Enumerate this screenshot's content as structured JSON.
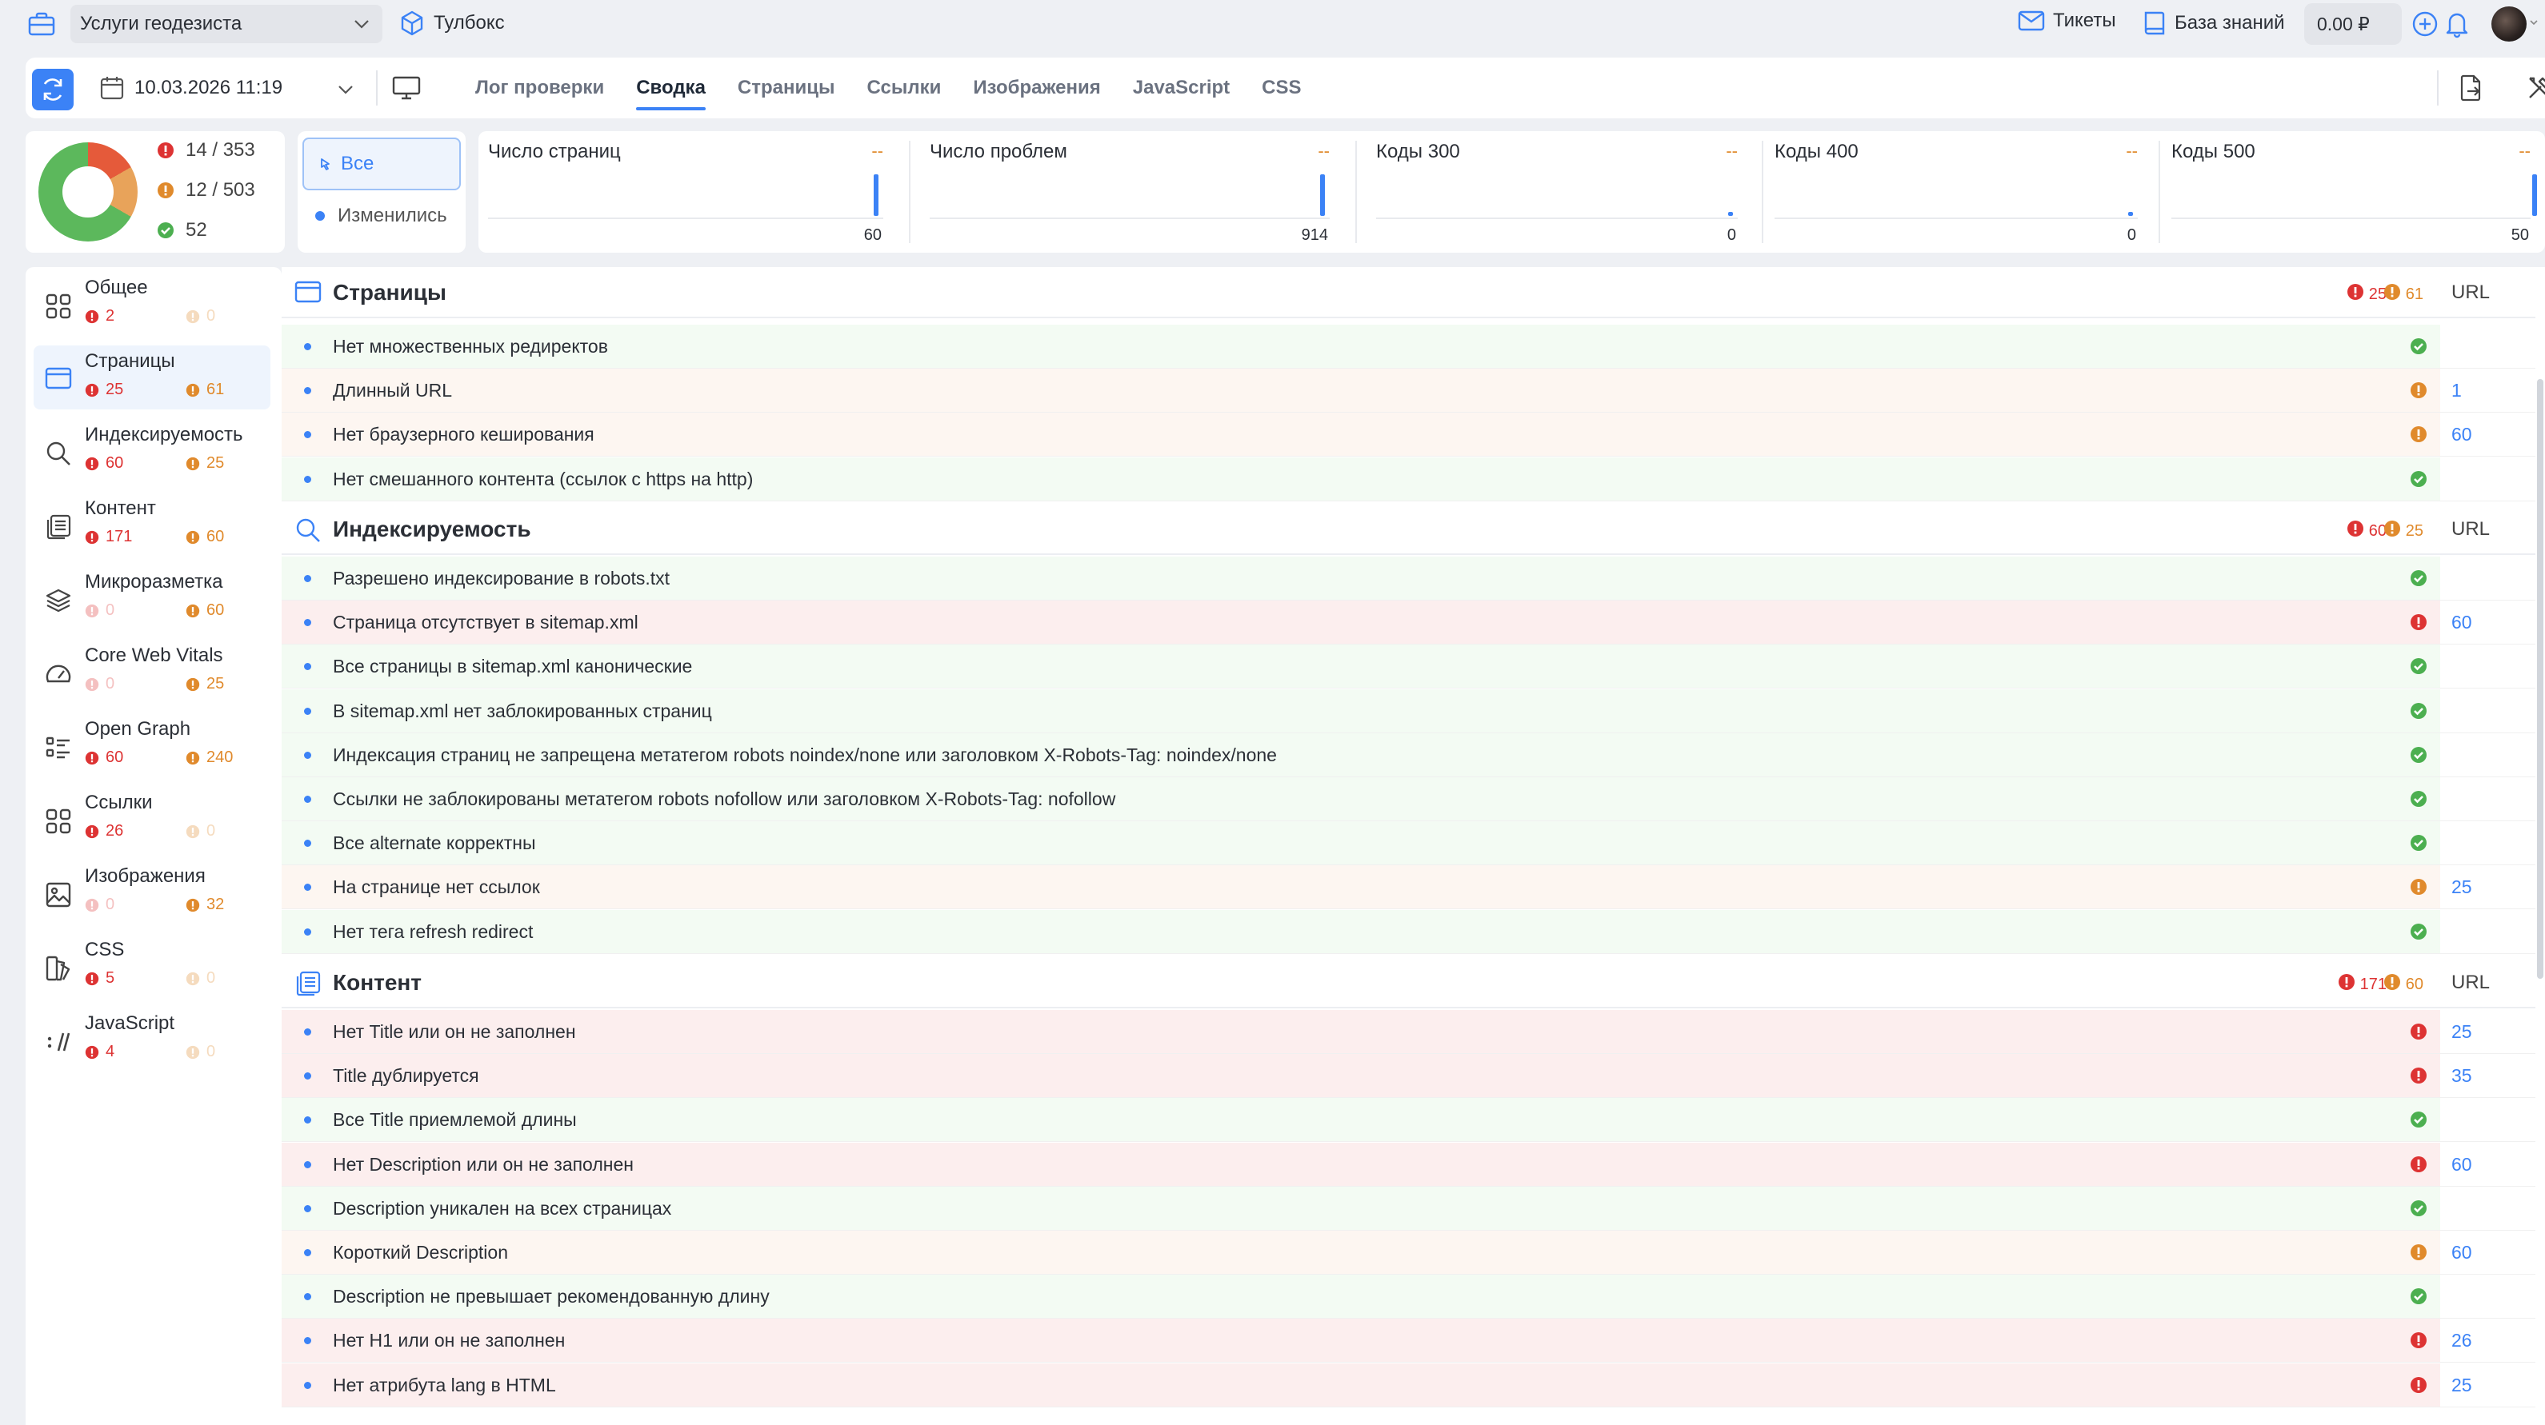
{
  "topbar": {
    "project": "Услуги геодезиста",
    "toolbox": "Тулбокс",
    "tickets": "Тикеты",
    "knowledge_base": "База знаний",
    "balance": "0.00 ₽"
  },
  "tabbar": {
    "date": "10.03.2026 11:19",
    "tabs": [
      "Лог проверки",
      "Сводка",
      "Страницы",
      "Ссылки",
      "Изображения",
      "JavaScript",
      "CSS"
    ],
    "active_tab": "Сводка"
  },
  "summary": {
    "errors": "14 / 353",
    "warnings": "12 / 503",
    "ok": "52",
    "filter_all": "Все",
    "filter_changed": "Изменились"
  },
  "metrics": [
    {
      "title": "Число страниц",
      "delta": "--",
      "value": "60"
    },
    {
      "title": "Число проблем",
      "delta": "--",
      "value": "914"
    },
    {
      "title": "Коды 300",
      "delta": "--",
      "value": "0"
    },
    {
      "title": "Коды 400",
      "delta": "--",
      "value": "0"
    },
    {
      "title": "Коды 500",
      "delta": "--",
      "value": "50"
    }
  ],
  "sidebar": [
    {
      "label": "Общее",
      "err": "2",
      "warn": "0",
      "icon": "grid-icon"
    },
    {
      "label": "Страницы",
      "err": "25",
      "warn": "61",
      "icon": "browser-window-icon"
    },
    {
      "label": "Индексируемость",
      "err": "60",
      "warn": "25",
      "icon": "search-icon"
    },
    {
      "label": "Контент",
      "err": "171",
      "warn": "60",
      "icon": "documents-icon"
    },
    {
      "label": "Микроразметка",
      "err": "0",
      "warn": "60",
      "icon": "layers-icon"
    },
    {
      "label": "Core Web Vitals",
      "err": "0",
      "warn": "25",
      "icon": "speedometer-icon"
    },
    {
      "label": "Open Graph",
      "err": "60",
      "warn": "240",
      "icon": "list-icon"
    },
    {
      "label": "Ссылки",
      "err": "26",
      "warn": "0",
      "icon": "grid-icon"
    },
    {
      "label": "Изображения",
      "err": "0",
      "warn": "32",
      "icon": "image-icon"
    },
    {
      "label": "CSS",
      "err": "5",
      "warn": "0",
      "icon": "css-icon"
    },
    {
      "label": "JavaScript",
      "err": "4",
      "warn": "0",
      "icon": "js-icon"
    }
  ],
  "sections": {
    "pages": {
      "title": "Страницы",
      "err": "25",
      "warn": "61",
      "url_header": "URL",
      "rows": [
        {
          "text": "Нет множественных редиректов",
          "status": "ok",
          "count": ""
        },
        {
          "text": "Длинный URL",
          "status": "warn",
          "count": "1"
        },
        {
          "text": "Нет браузерного кеширования",
          "status": "warn",
          "count": "60"
        },
        {
          "text": "Нет смешанного контента (ссылок с https на http)",
          "status": "ok",
          "count": ""
        }
      ]
    },
    "index": {
      "title": "Индексируемость",
      "err": "60",
      "warn": "25",
      "url_header": "URL",
      "rows": [
        {
          "text": "Разрешено индексирование в robots.txt",
          "status": "ok",
          "count": ""
        },
        {
          "text": "Страница отсутствует в sitemap.xml",
          "status": "err",
          "count": "60"
        },
        {
          "text": "Все страницы в sitemap.xml канонические",
          "status": "ok",
          "count": ""
        },
        {
          "text": "В sitemap.xml нет заблокированных страниц",
          "status": "ok",
          "count": ""
        },
        {
          "text": "Индексация страниц не запрещена метатегом robots noindex/none или заголовком X-Robots-Tag: noindex/none",
          "status": "ok",
          "count": ""
        },
        {
          "text": "Ссылки не заблокированы метатегом robots nofollow или заголовком X-Robots-Tag: nofollow",
          "status": "ok",
          "count": ""
        },
        {
          "text": "Все alternate корректны",
          "status": "ok",
          "count": ""
        },
        {
          "text": "На странице нет ссылок",
          "status": "warn",
          "count": "25"
        },
        {
          "text": "Нет тега refresh redirect",
          "status": "ok",
          "count": ""
        }
      ]
    },
    "content": {
      "title": "Контент",
      "err": "171",
      "warn": "60",
      "url_header": "URL",
      "rows": [
        {
          "text": "Нет Title или он не заполнен",
          "status": "err",
          "count": "25"
        },
        {
          "text": "Title дублируется",
          "status": "err",
          "count": "35"
        },
        {
          "text": "Все Title приемлемой длины",
          "status": "ok",
          "count": ""
        },
        {
          "text": "Нет Description или он не заполнен",
          "status": "err",
          "count": "60"
        },
        {
          "text": "Description уникален на всех страницах",
          "status": "ok",
          "count": ""
        },
        {
          "text": "Короткий Description",
          "status": "warn",
          "count": "60"
        },
        {
          "text": "Description не превышает рекомендованную длину",
          "status": "ok",
          "count": ""
        },
        {
          "text": "Нет H1 или он не заполнен",
          "status": "err",
          "count": "26"
        },
        {
          "text": "Нет атрибута lang в HTML",
          "status": "err",
          "count": "25"
        }
      ]
    }
  }
}
